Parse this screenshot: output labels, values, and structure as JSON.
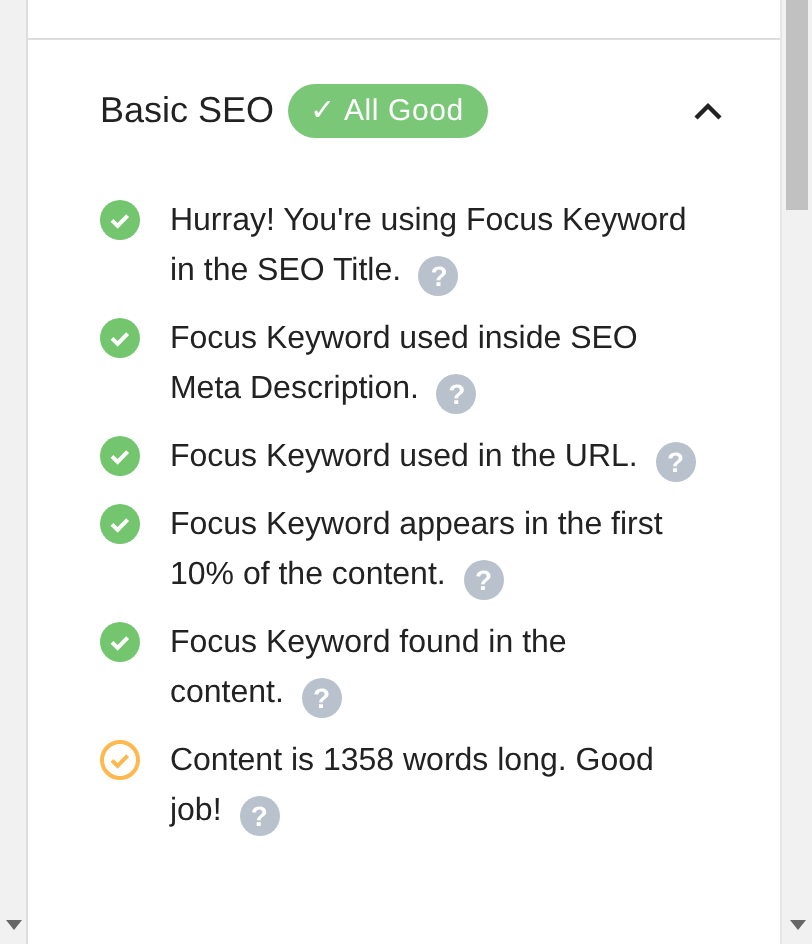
{
  "section": {
    "title": "Basic SEO",
    "badge": {
      "icon": "✓",
      "label": "All Good"
    },
    "expanded": true
  },
  "checks": [
    {
      "kind": "ok",
      "text": "Hurray! You're using Focus Keyword in the SEO Title.",
      "help": "?"
    },
    {
      "kind": "ok",
      "text": "Focus Keyword used inside SEO Meta Description.",
      "help": "?"
    },
    {
      "kind": "ok",
      "text": "Focus Keyword used in the URL.",
      "help": "?"
    },
    {
      "kind": "ok",
      "text": "Focus Keyword appears in the first 10% of the content.",
      "help": "?"
    },
    {
      "kind": "ok",
      "text": "Focus Keyword found in the content.",
      "help": "?"
    },
    {
      "kind": "warning",
      "text": "Content is 1358 words long. Good job!",
      "help": "?"
    }
  ]
}
